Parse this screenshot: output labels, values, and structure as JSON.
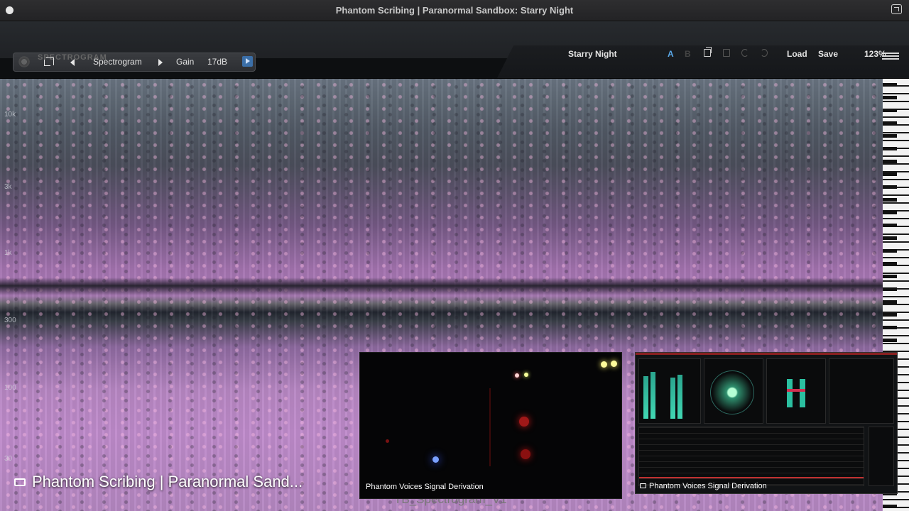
{
  "window": {
    "title": "Phantom Scribing | Paranormal Sandbox: Starry Night"
  },
  "toolbar": {
    "logo_text": "SPECTROGRAM",
    "view_label": "Spectrogram",
    "gain_label": "Gain",
    "gain_value": "17dB"
  },
  "header": {
    "preset_name": "Starry Night",
    "slot_a": "A",
    "slot_b": "B",
    "load_label": "Load",
    "save_label": "Save",
    "zoom": "123%"
  },
  "spectrogram": {
    "freq_labels": [
      "10k",
      "3k",
      "1k",
      "300",
      "100",
      "30"
    ]
  },
  "captions": {
    "main_share": "Phantom Scribing | Paranormal Sand...",
    "ghost_text": "TB_Spectrogram_V1",
    "video_tile": "Phantom Voices Signal Derivation",
    "meter_tile": "Phantom Voices Signal Derivation"
  },
  "colors": {
    "accent_blue": "#5aa8e8",
    "play_button": "#3b6fa8",
    "meter_green": "#41d7b3",
    "meter_red": "#c03030"
  },
  "icons": [
    "window-dot-icon",
    "fullscreen-icon",
    "crop-icon",
    "arrow-left-icon",
    "arrow-right-icon",
    "play-icon",
    "hamburger-menu-icon",
    "copy-icon",
    "paste-icon",
    "undo-icon",
    "redo-icon",
    "screen-share-icon"
  ]
}
